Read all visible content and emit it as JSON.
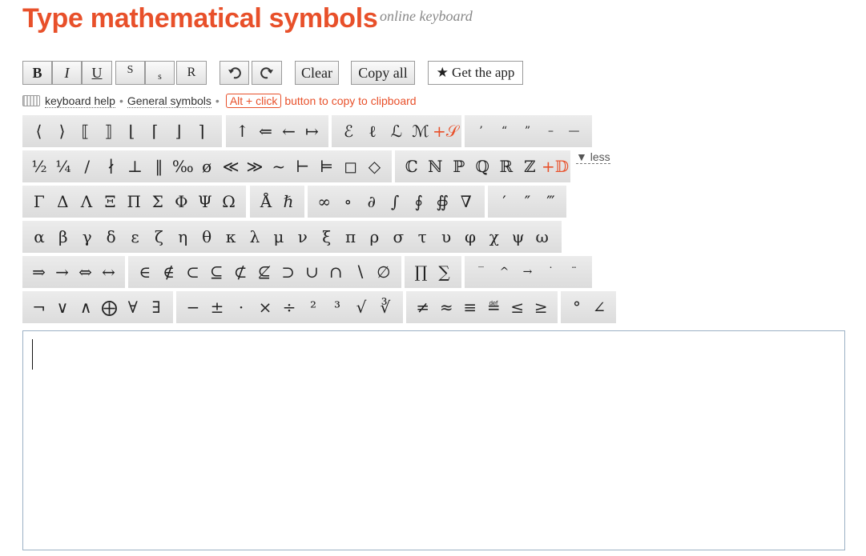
{
  "header": {
    "title": "Type mathematical symbols",
    "subtitle": "online keyboard"
  },
  "toolbar": {
    "bold": "B",
    "italic": "I",
    "underline": "U",
    "superscript": "S",
    "subscript": "s",
    "reset": "R",
    "clear": "Clear",
    "copy_all": "Copy all",
    "get_app": "★ Get the app"
  },
  "help": {
    "keyboard_help": "keyboard help",
    "separator": "•",
    "general_symbols": "General symbols",
    "alt_click": "Alt + click",
    "note": "button to copy to clipboard",
    "less": "▼ less"
  },
  "rows": {
    "r1a": [
      "⟨",
      "⟩",
      "⟦",
      "⟧",
      "⌊",
      "⌈",
      "⌋",
      "⌉"
    ],
    "r1b": [
      "↑",
      "⇐",
      "←",
      "↦"
    ],
    "r1c": [
      "ℰ",
      "ℓ",
      "ℒ",
      "ℳ",
      "+𝒮"
    ],
    "r1d": [
      "’",
      "“",
      "”",
      "–",
      "—"
    ],
    "r2a": [
      "½",
      "¼",
      "/",
      "∤",
      "⊥",
      "‖",
      "‰",
      "ø",
      "≪",
      "≫",
      "~",
      "⊢",
      "⊨",
      "◻",
      "◇"
    ],
    "r2b": [
      "ℂ",
      "ℕ",
      "ℙ",
      "ℚ",
      "ℝ",
      "ℤ",
      "+𝔻"
    ],
    "r3a": [
      "Γ",
      "Δ",
      "Λ",
      "Ξ",
      "Π",
      "Σ",
      "Φ",
      "Ψ",
      "Ω"
    ],
    "r3b": [
      "Å",
      "ℏ"
    ],
    "r3c": [
      "∞",
      "∘",
      "∂",
      "∫",
      "∮",
      "∯",
      "∇"
    ],
    "r3d": [
      "′",
      "″",
      "‴"
    ],
    "r4a": [
      "α",
      "β",
      "γ",
      "δ",
      "ε",
      "ζ",
      "η",
      "θ",
      "κ",
      "λ",
      "μ",
      "ν",
      "ξ",
      "π",
      "ρ",
      "σ",
      "τ",
      "υ",
      "φ",
      "χ",
      "ψ",
      "ω"
    ],
    "r5a": [
      "⇒",
      "→",
      "⇔",
      "↔"
    ],
    "r5b": [
      "∈",
      "∉",
      "⊂",
      "⊆",
      "⊄",
      "⊈",
      "⊃",
      "∪",
      "∩",
      "∖",
      "∅"
    ],
    "r5c": [
      "∏",
      "∑"
    ],
    "r5d": [
      "‾",
      "^",
      "→",
      "˙",
      "¨"
    ],
    "r6a": [
      "¬",
      "∨",
      "∧",
      "⨁",
      "∀",
      "∃"
    ],
    "r6b": [
      "−",
      "±",
      "·",
      "×",
      "÷",
      "²",
      "³",
      "√",
      "∛"
    ],
    "r6c": [
      "≠",
      "≈",
      "≡",
      "≝",
      "≤",
      "≥"
    ],
    "r6d": [
      "°",
      "∠"
    ]
  }
}
